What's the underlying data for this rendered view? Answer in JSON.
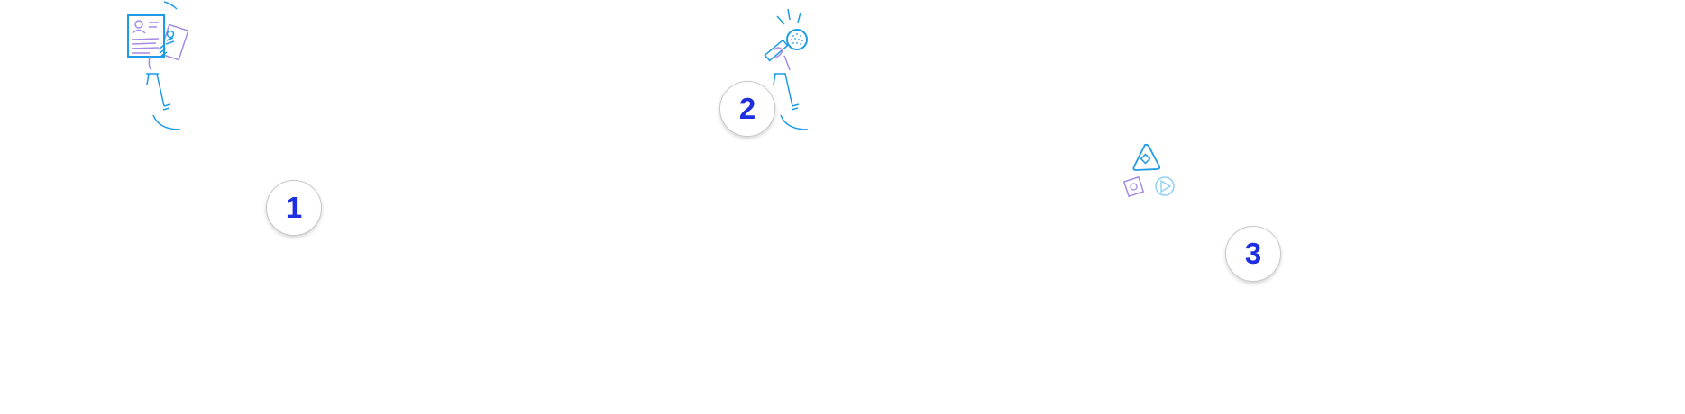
{
  "colors": {
    "accent_blue": "#1f2fe0",
    "line_blue": "#1e9be6",
    "line_purple": "#a58ae6",
    "badge_border": "#c8c8c8"
  },
  "steps": [
    {
      "number": "1",
      "illustration": "person-holding-documents-icon"
    },
    {
      "number": "2",
      "illustration": "person-holding-microphone-icon"
    },
    {
      "number": "3",
      "illustration": "shapes-play-icon"
    }
  ]
}
